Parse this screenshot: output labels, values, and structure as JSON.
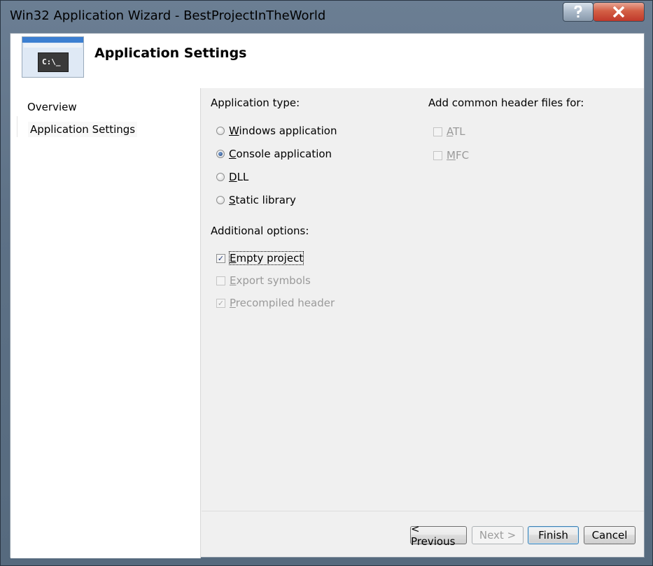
{
  "window": {
    "title": "Win32 Application Wizard - BestProjectInTheWorld"
  },
  "header": {
    "title": "Application Settings"
  },
  "header_image": {
    "console_text": "C:\\_"
  },
  "nav": {
    "items": [
      "Overview",
      "Application Settings"
    ],
    "selected": "Application Settings"
  },
  "app_type": {
    "label": "Application type:",
    "options": [
      {
        "pre": "",
        "key": "W",
        "rest": "indows application",
        "checked": false
      },
      {
        "pre": "",
        "key": "C",
        "rest": "onsole application",
        "checked": true
      },
      {
        "pre": "",
        "key": "D",
        "rest": "LL",
        "checked": false
      },
      {
        "pre": "",
        "key": "S",
        "rest": "tatic library",
        "checked": false
      }
    ]
  },
  "additional": {
    "label": "Additional options:",
    "options": [
      {
        "key": "E",
        "rest": "mpty project",
        "checked": true,
        "enabled": true
      },
      {
        "key": "E",
        "rest": "xport symbols",
        "checked": false,
        "enabled": false
      },
      {
        "key": "P",
        "rest": "recompiled header",
        "checked": true,
        "enabled": false
      }
    ]
  },
  "header_files": {
    "label": "Add common header files for:",
    "options": [
      {
        "key": "A",
        "rest": "TL",
        "checked": false,
        "enabled": false
      },
      {
        "key": "M",
        "rest": "FC",
        "checked": false,
        "enabled": false
      }
    ]
  },
  "buttons": {
    "previous": "< Previous",
    "next": "Next >",
    "finish": "Finish",
    "cancel": "Cancel"
  },
  "icons": {
    "help": "question-mark-icon",
    "close": "x-close-icon",
    "check": "✓"
  }
}
